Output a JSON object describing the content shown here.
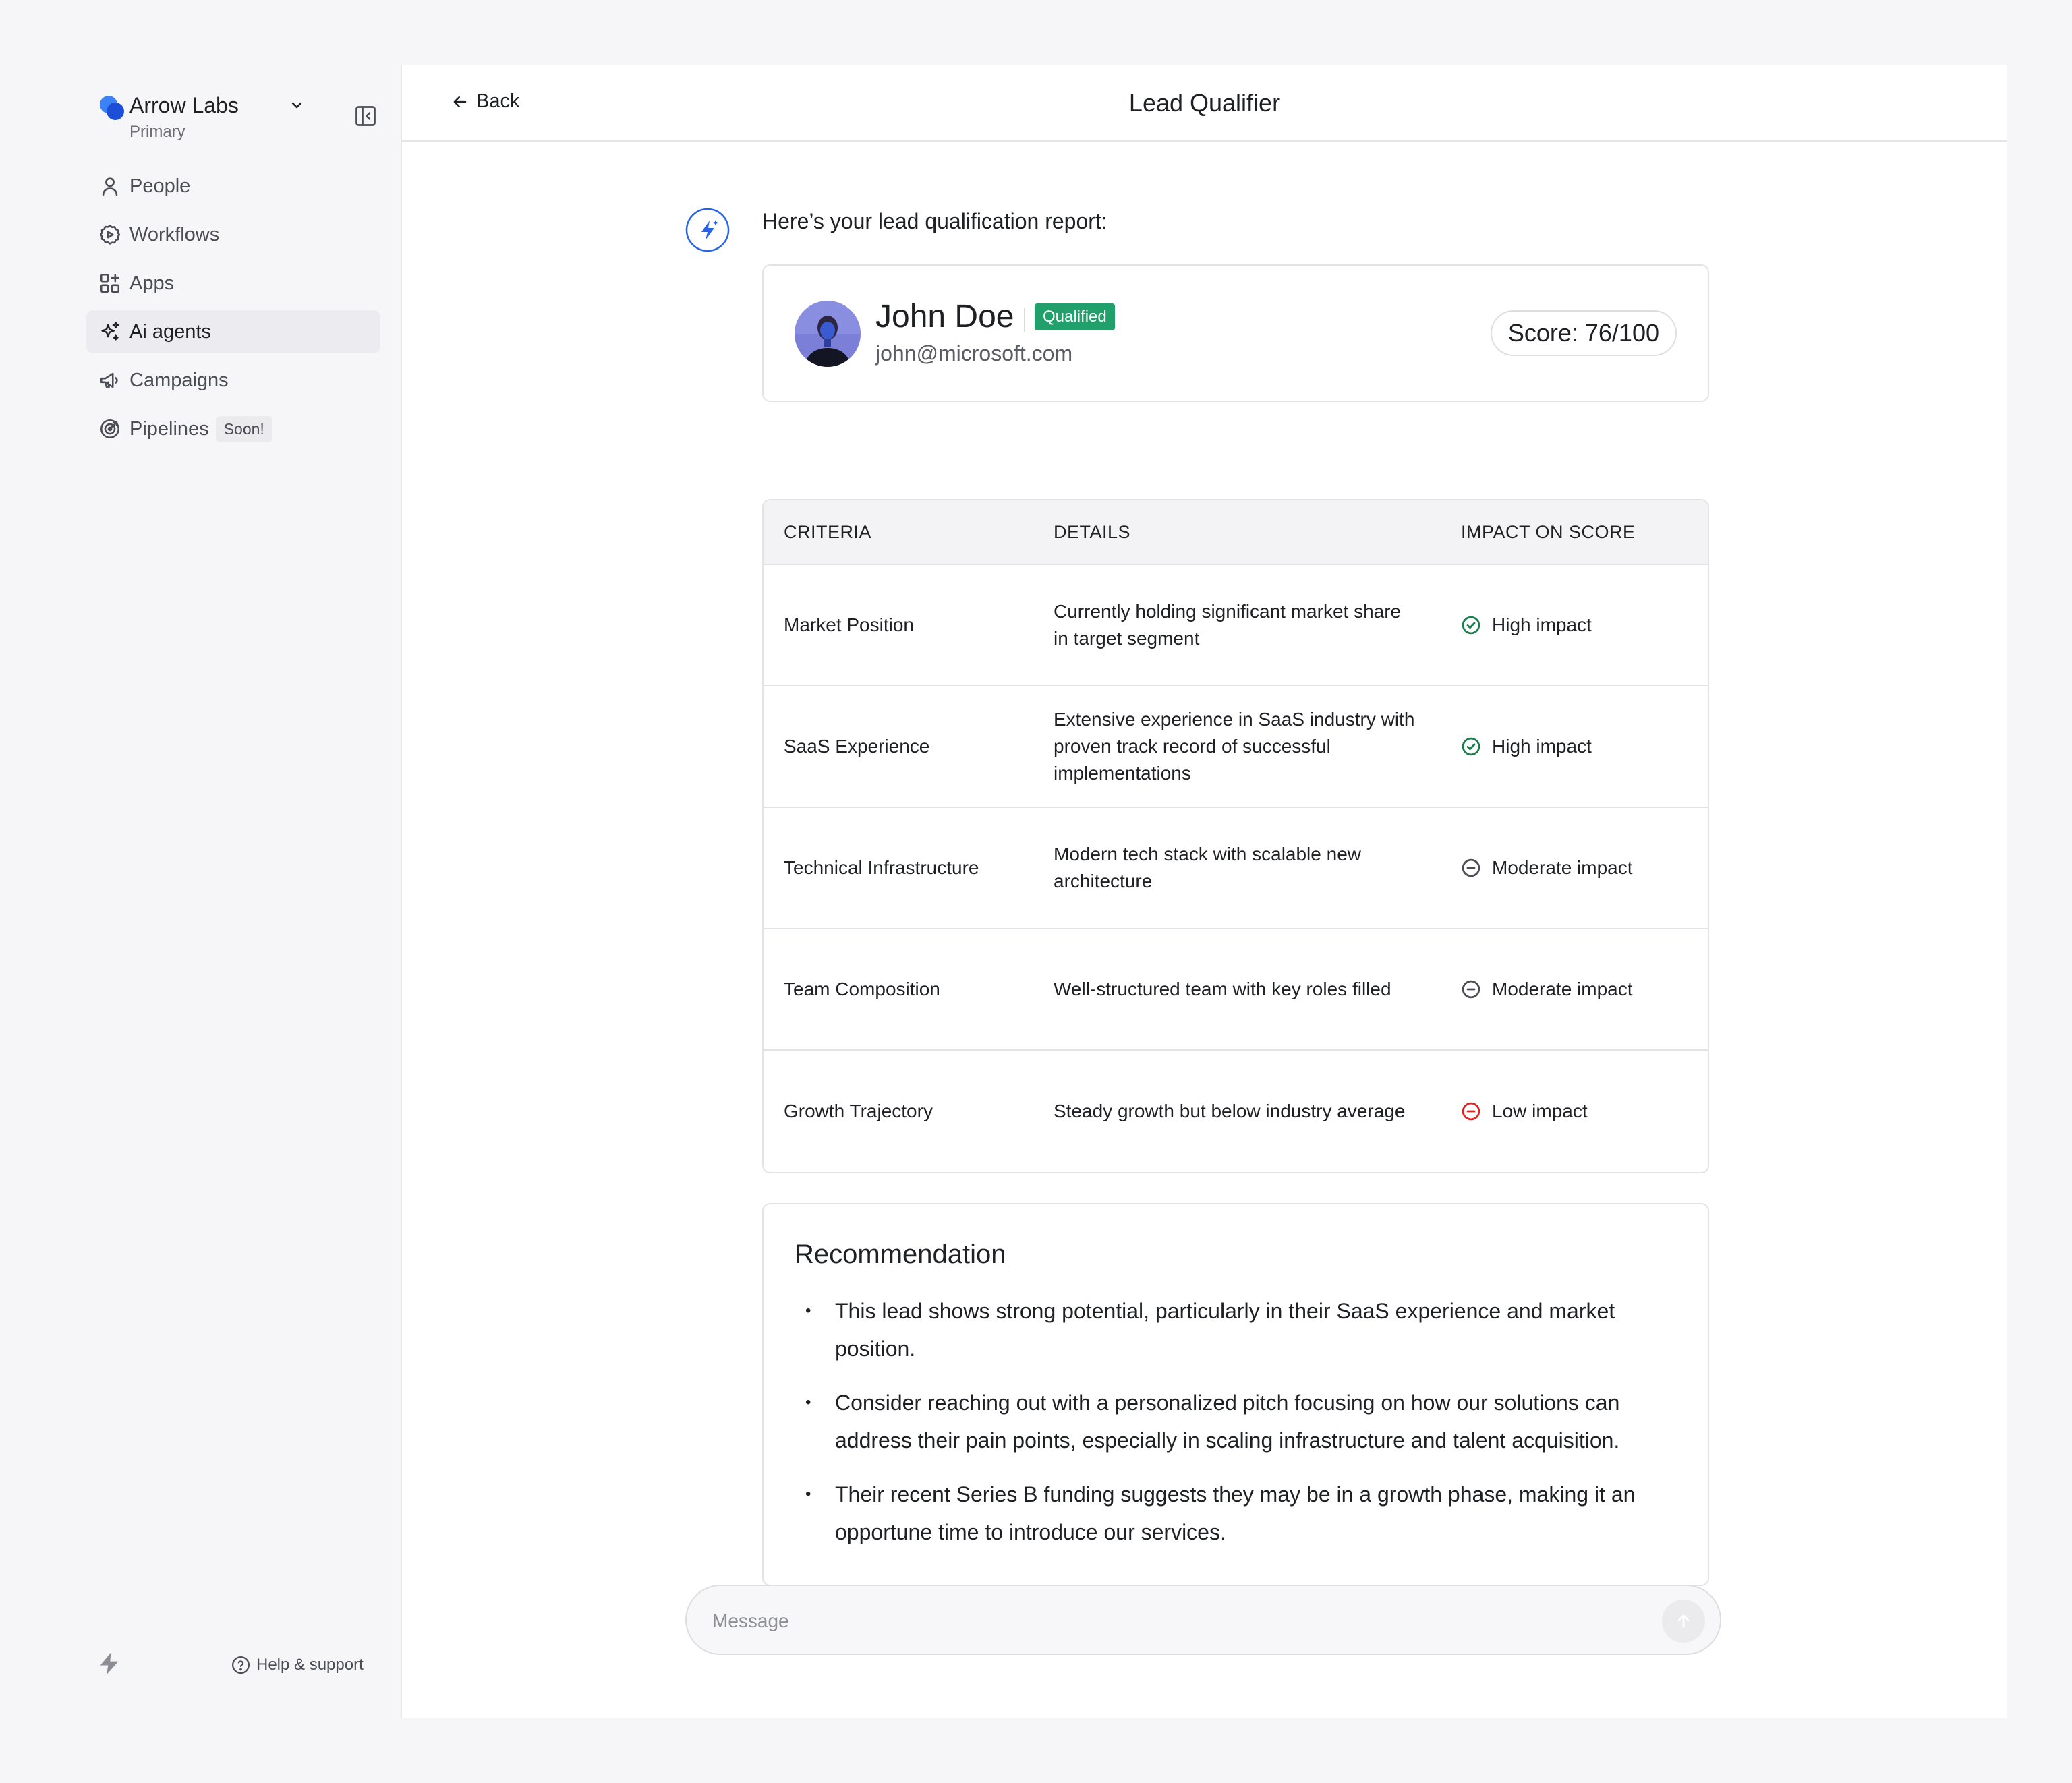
{
  "sidebar": {
    "workspace_name": "Arrow Labs",
    "workspace_sub": "Primary",
    "items": [
      {
        "label": "People",
        "icon": "person-icon"
      },
      {
        "label": "Workflows",
        "icon": "workflow-icon"
      },
      {
        "label": "Apps",
        "icon": "apps-icon"
      },
      {
        "label": "Ai agents",
        "icon": "sparkle-icon",
        "active": true
      },
      {
        "label": "Campaigns",
        "icon": "megaphone-icon"
      },
      {
        "label": "Pipelines",
        "icon": "target-icon",
        "badge": "Soon!"
      }
    ],
    "help_label": "Help & support"
  },
  "header": {
    "back_label": "Back",
    "title": "Lead Qualifier"
  },
  "chat": {
    "intro": "Here’s your lead qualification report:"
  },
  "lead": {
    "name": "John Doe",
    "status": "Qualified",
    "email": "john@microsoft.com",
    "score": "Score: 76/100"
  },
  "table": {
    "headers": [
      "CRITERIA",
      "DETAILS",
      "IMPACT ON SCORE"
    ],
    "rows": [
      {
        "criteria": "Market Position",
        "details": "Currently holding significant market share in target segment",
        "impact": "High impact",
        "level": "high"
      },
      {
        "criteria": "SaaS Experience",
        "details": "Extensive experience in SaaS industry with proven track record of successful implementations",
        "impact": "High impact",
        "level": "high"
      },
      {
        "criteria": "Technical Infrastructure",
        "details": "Modern tech stack with scalable new architecture",
        "impact": "Moderate impact",
        "level": "moderate"
      },
      {
        "criteria": "Team Composition",
        "details": "Well-structured team with key roles filled",
        "impact": "Moderate impact",
        "level": "moderate"
      },
      {
        "criteria": "Growth Trajectory",
        "details": "Steady growth but below industry average",
        "impact": "Low impact",
        "level": "low"
      }
    ]
  },
  "recommendation": {
    "title": "Recommendation",
    "items": [
      "This lead shows strong potential, particularly in their SaaS experience and market position.",
      "Consider reaching out with a personalized pitch focusing on how our solutions can address their pain points, especially in scaling infrastructure and talent acquisition.",
      "Their recent Series B funding suggests they may be in a growth phase, making it an opportune time to introduce our services."
    ]
  },
  "composer": {
    "placeholder": "Message"
  },
  "colors": {
    "accent": "#2563eb",
    "qualified": "#22a06b",
    "high": "#1a7f4b",
    "moderate": "#4b4c54",
    "low": "#dc2626"
  }
}
